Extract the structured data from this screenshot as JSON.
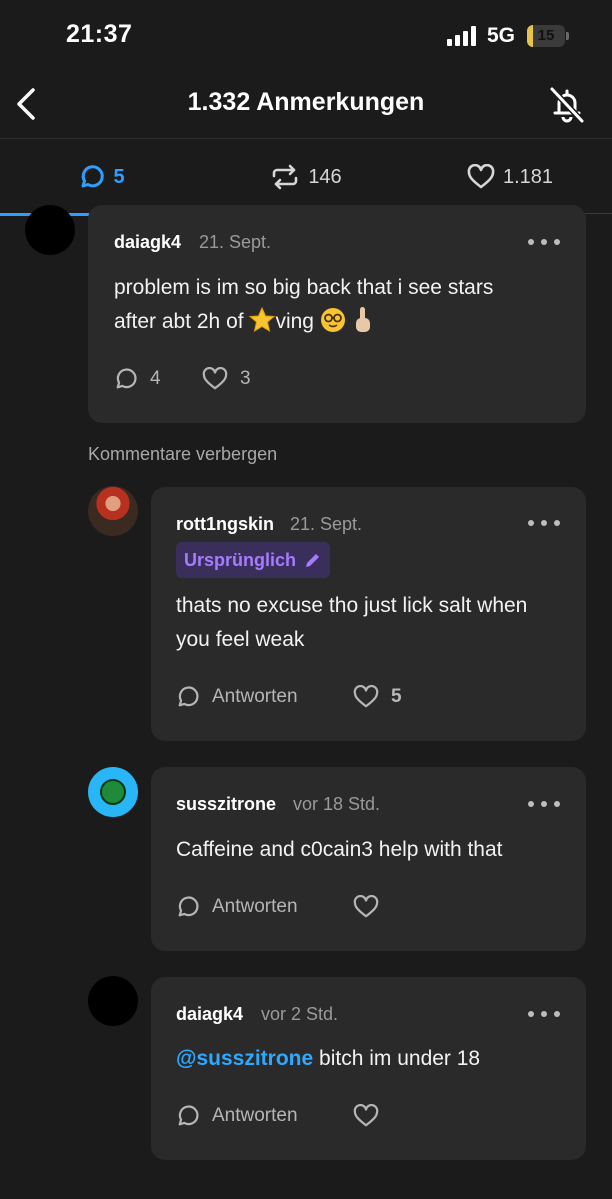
{
  "status_bar": {
    "time": "21:37",
    "network": "5G",
    "battery": "15",
    "battery_level": 0.15
  },
  "header": {
    "title": "1.332 Anmerkungen"
  },
  "tabs": [
    {
      "name": "replies",
      "count": "5"
    },
    {
      "name": "reblogs",
      "count": "146"
    },
    {
      "name": "likes",
      "count": "1.181"
    }
  ],
  "icons": {
    "back": "chevron-left-icon",
    "mute": "bell-off-icon",
    "reply": "speech-bubble-icon",
    "reblog": "repost-icon",
    "like": "heart-icon",
    "more": "ellipsis-icon",
    "edit": "pencil-icon"
  },
  "colors": {
    "accent": "#2f9fff",
    "background": "#1b1b1b",
    "card": "#2a2a2a",
    "original_badge": "#a57bff"
  },
  "comments": [
    {
      "username": "daiagk4",
      "time": "21. Sept.",
      "text_line1": "problem is im so big back that i see stars",
      "text_line2_a": "after abt 2h of ",
      "text_line2_b": "ving ",
      "reply_count": "4",
      "like_count": "3"
    },
    {
      "username": "rott1ngskin",
      "time": "21. Sept.",
      "badge": "Ursprünglich",
      "text": "thats no excuse tho just lick salt when you feel weak",
      "reply_label": "Antworten",
      "like_count": "5"
    },
    {
      "username": "susszitrone",
      "time": "vor 18 Std.",
      "text": "Caffeine and c0cain3 help with that",
      "reply_label": "Antworten"
    },
    {
      "username": "daiagk4",
      "time": "vor 2 Std.",
      "mention": "@susszitrone",
      "text": " bitch im under 18",
      "reply_label": "Antworten"
    }
  ],
  "hide_comments_label": "Kommentare verbergen"
}
